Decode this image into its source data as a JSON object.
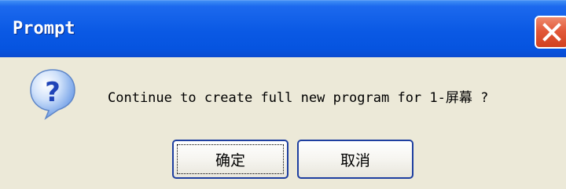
{
  "dialog": {
    "title": "Prompt",
    "message": "Continue to create full new program for 1-屏幕 ?",
    "buttons": {
      "ok_label": "确定",
      "cancel_label": "取消"
    }
  },
  "icons": {
    "close": "close-icon",
    "question": "question-icon"
  },
  "colors": {
    "titlebar": "#0A59E4",
    "close_button": "#E2593A",
    "dialog_bg": "#ECE9D8"
  }
}
